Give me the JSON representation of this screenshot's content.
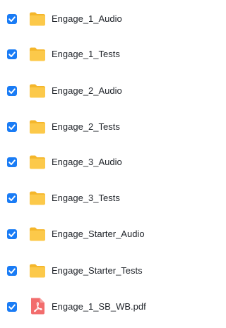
{
  "files": [
    {
      "name": "Engage_1_Audio",
      "type": "folder",
      "checked": true
    },
    {
      "name": "Engage_1_Tests",
      "type": "folder",
      "checked": true
    },
    {
      "name": "Engage_2_Audio",
      "type": "folder",
      "checked": true
    },
    {
      "name": "Engage_2_Tests",
      "type": "folder",
      "checked": true
    },
    {
      "name": "Engage_3_Audio",
      "type": "folder",
      "checked": true
    },
    {
      "name": "Engage_3_Tests",
      "type": "folder",
      "checked": true
    },
    {
      "name": "Engage_Starter_Audio",
      "type": "folder",
      "checked": true
    },
    {
      "name": "Engage_Starter_Tests",
      "type": "folder",
      "checked": true
    },
    {
      "name": "Engage_1_SB_WB.pdf",
      "type": "pdf",
      "checked": true
    }
  ],
  "colors": {
    "checkbox": "#1a7cf5",
    "folder": "#fbc43d",
    "pdf": "#f26d6d"
  },
  "icons": {
    "checkbox": "checkmark-icon",
    "folder": "folder-icon",
    "pdf": "pdf-icon"
  }
}
